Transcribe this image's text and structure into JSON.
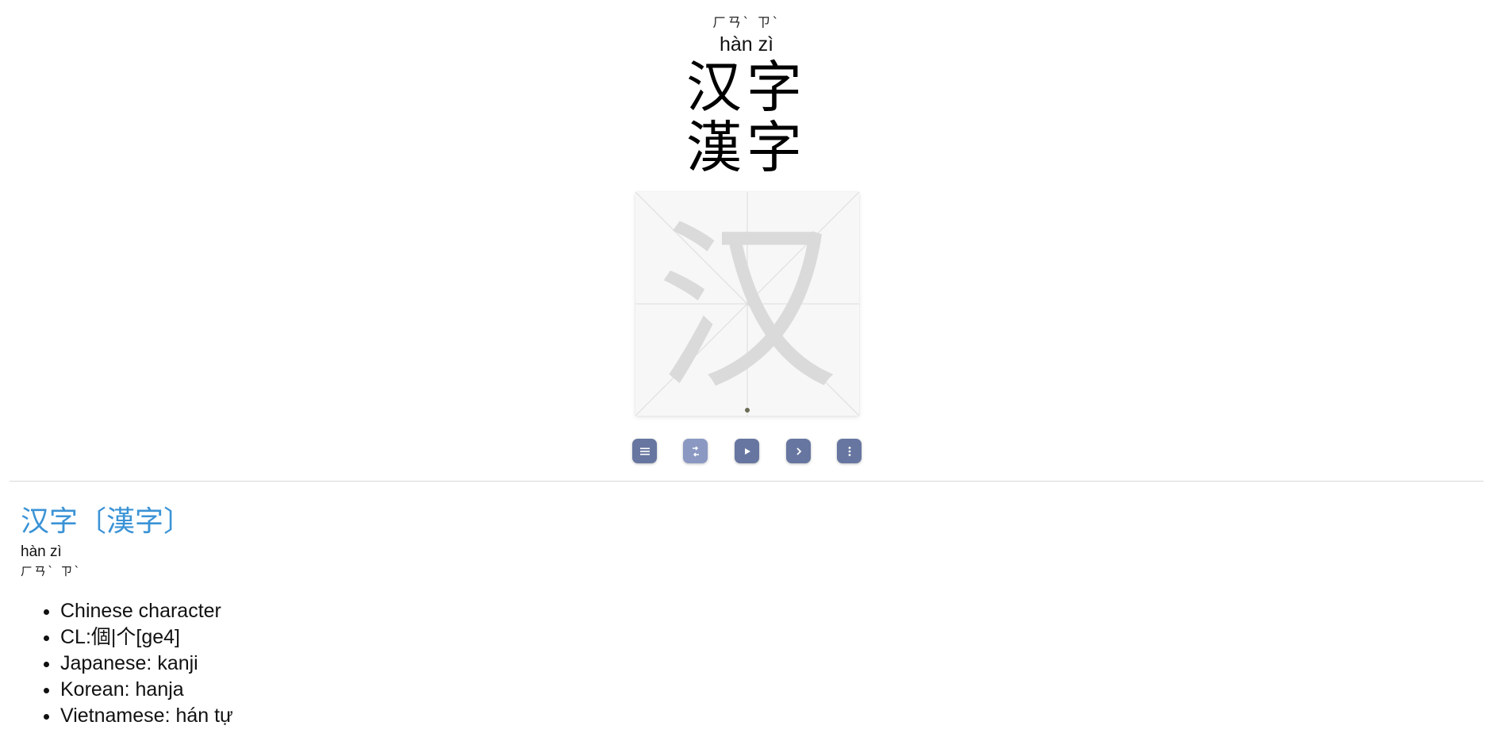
{
  "hero": {
    "bopomofo": "ㄏㄢˋ ㄗˋ",
    "pinyin": "hàn zì",
    "simplified": "汉字",
    "traditional": "漢字"
  },
  "canvas": {
    "character": "汉"
  },
  "toolbar": {
    "buttons": [
      {
        "name": "menu-icon"
      },
      {
        "name": "swap-icon"
      },
      {
        "name": "play-icon"
      },
      {
        "name": "chevron-right-icon"
      },
      {
        "name": "more-vertical-icon"
      }
    ]
  },
  "entry": {
    "simplified": "汉字",
    "open_bracket": "〔",
    "traditional": "漢字",
    "close_bracket": "〕",
    "pinyin": "hàn zì",
    "bopomofo": "ㄏㄢˋ ㄗˋ",
    "definitions": [
      "Chinese character",
      "CL:個|个[ge4]",
      "Japanese: kanji",
      "Korean: hanja",
      "Vietnamese: hán tự"
    ]
  },
  "colors": {
    "accent": "#3a93d6",
    "button": "#6776a0",
    "button_active": "#8a98c2"
  }
}
